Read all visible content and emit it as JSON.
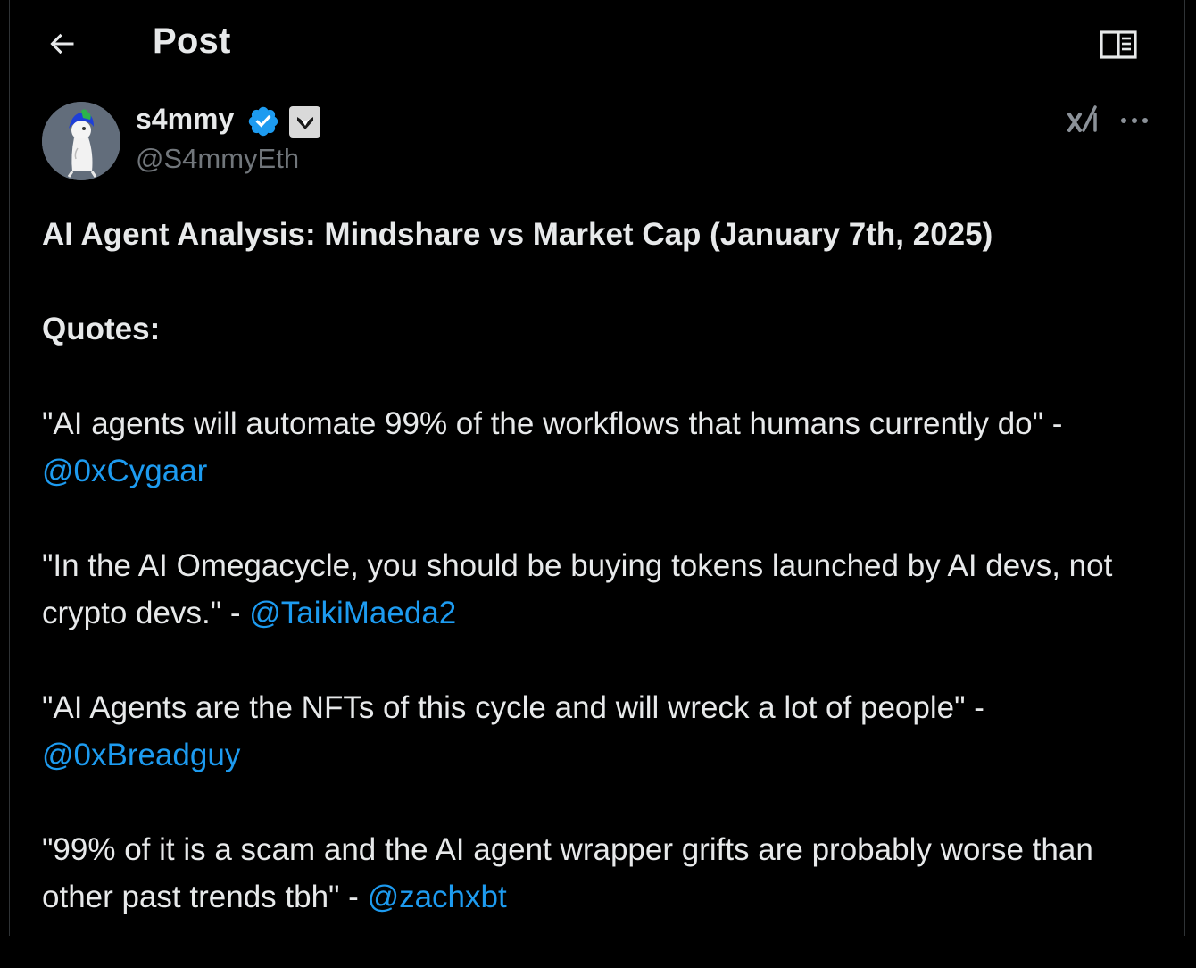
{
  "header": {
    "title": "Post",
    "back_icon": "arrow-left-icon",
    "reader_icon": "open-book-icon"
  },
  "author": {
    "name": "s4mmy",
    "handle": "@S4mmyEth",
    "verified_icon": "verified-badge-icon",
    "affiliate_icon": "affiliate-badge-icon"
  },
  "actions": {
    "grok_icon": "grok-icon",
    "more_icon": "more-horizontal-icon"
  },
  "post": {
    "title": "AI Agent Analysis: Mindshare vs Market Cap (January 7th, 2025)",
    "quotes_heading": "Quotes:",
    "quotes": [
      {
        "text": "\"AI agents will automate 99% of the workflows that humans currently do\" - ",
        "mention": "@0xCygaar"
      },
      {
        "text": "\"In the AI Omegacycle, you should be buying tokens launched by AI devs, not crypto devs.\" - ",
        "mention": "@TaikiMaeda2"
      },
      {
        "text": "\"AI Agents are the NFTs of this cycle and will wreck a lot of people\" - ",
        "mention": "@0xBreadguy"
      },
      {
        "text": "\"99% of it is a scam and the AI agent wrapper grifts are probably worse than other past trends tbh\" - ",
        "mention": "@zachxbt"
      }
    ]
  },
  "colors": {
    "background": "#000000",
    "text": "#e7e9ea",
    "secondary_text": "#71767b",
    "link": "#1d9bf0",
    "verified": "#1d9bf0",
    "divider": "#2f3336"
  }
}
